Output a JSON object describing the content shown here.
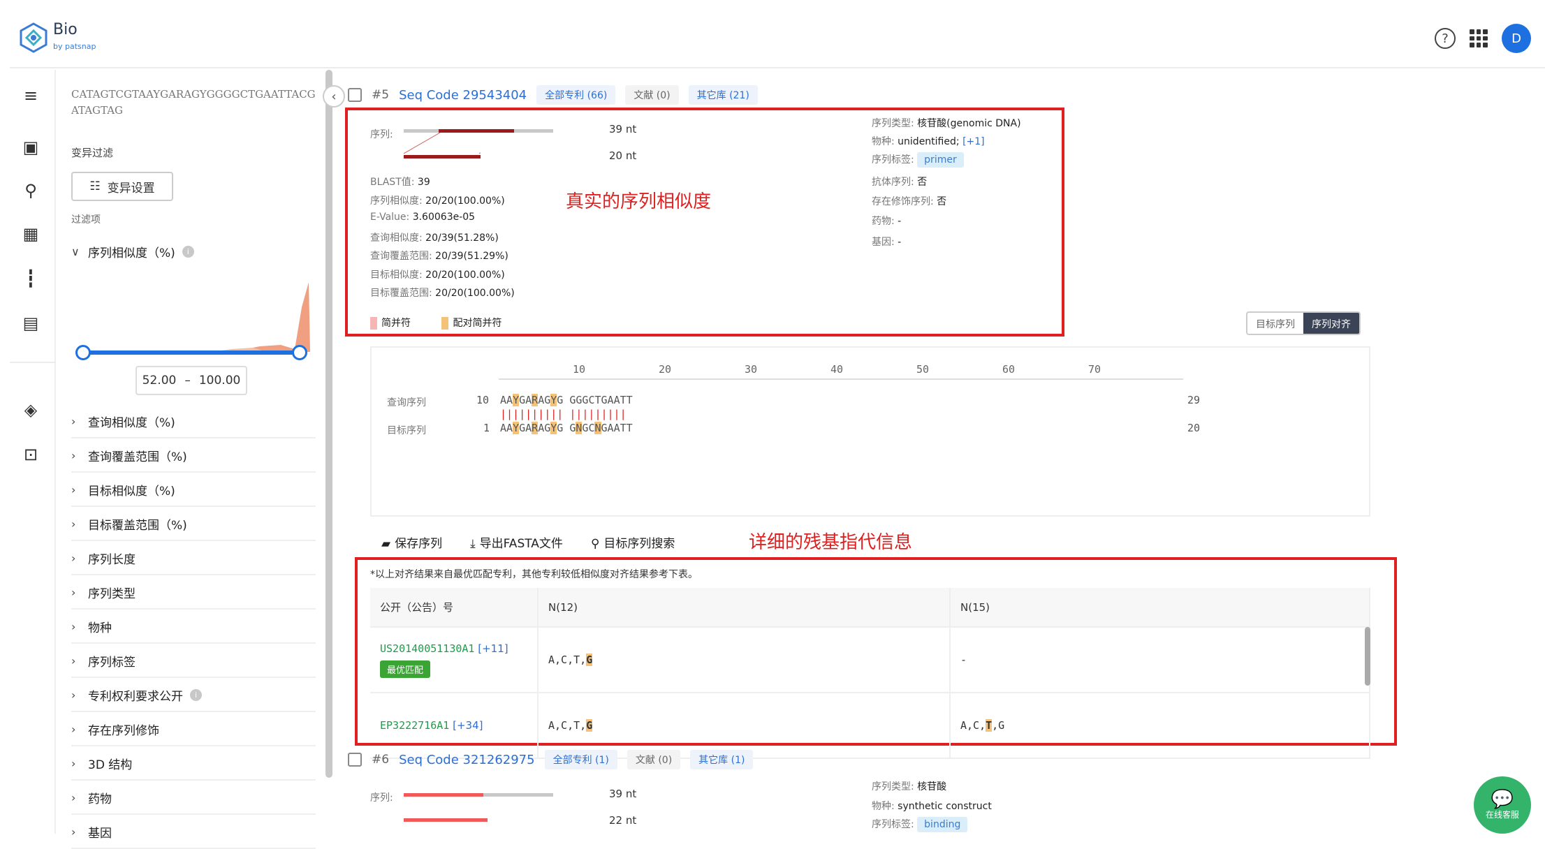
{
  "app": {
    "name": "Bio",
    "byline": "by patsnap",
    "avatar_letter": "D",
    "help_icon": "?"
  },
  "rail_icons": [
    "menu-collapse-icon",
    "document-icon",
    "search-icon",
    "structure-search-icon",
    "barcode-icon",
    "chart-icon",
    "layers-icon",
    "inbox-icon"
  ],
  "panel": {
    "query_sequence": "CATAGTCGTAAYGARAGYGGGGCTGAATTACGATAGTAG",
    "variant_filter_label": "变异过滤",
    "variant_button": "变异设置",
    "filters_label": "过滤项",
    "similarity_filter": "序列相似度（%)",
    "range_min": "52.00",
    "range_sep": "–",
    "range_max": "100.00",
    "filters": [
      "查询相似度（%)",
      "查询覆盖范围（%)",
      "目标相似度（%)",
      "目标覆盖范围（%)",
      "序列长度",
      "序列类型",
      "物种",
      "序列标签",
      "专利权利要求公开",
      "存在序列修饰",
      "3D 结构",
      "药物",
      "基因"
    ]
  },
  "result5": {
    "num": "#5",
    "seq_code": "Seq Code 29543404",
    "tags": [
      "全部专利 (66)",
      "文献 (0)",
      "其它库 (21)"
    ],
    "seq_label": "序列:",
    "query_len": "39 nt",
    "target_len": "20 nt",
    "metrics": [
      {
        "k": "BLAST值:",
        "v": "39"
      },
      {
        "k": "序列相似度:",
        "v": "20/20(100.00%)"
      },
      {
        "k": "E-Value:",
        "v": "3.60063e-05"
      },
      {
        "k": "查询相似度:",
        "v": "20/39(51.28%)"
      },
      {
        "k": "查询覆盖范围:",
        "v": "20/39(51.29%)"
      },
      {
        "k": "目标相似度:",
        "v": "20/20(100.00%)"
      },
      {
        "k": "目标覆盖范围:",
        "v": "20/20(100.00%)"
      }
    ],
    "right": [
      {
        "k": "序列类型:",
        "v": "核苷酸(genomic DNA)"
      },
      {
        "k": "物种:",
        "v": "unidentified;",
        "extra": "[+1]"
      },
      {
        "k": "序列标签:",
        "v": "primer"
      },
      {
        "k": "抗体序列:",
        "v": "否"
      },
      {
        "k": "存在修饰序列:",
        "v": "否"
      },
      {
        "k": "药物:",
        "v": "-"
      },
      {
        "k": "基因:",
        "v": "-"
      }
    ],
    "legend": [
      "简并符",
      "配对简并符"
    ],
    "annotation": "真实的序列相似度"
  },
  "toggle": {
    "a": "目标序列",
    "b": "序列对齐"
  },
  "alignment": {
    "ruler": [
      "10",
      "20",
      "30",
      "40",
      "50",
      "60",
      "70"
    ],
    "query_label": "查询序列",
    "query_start": "10",
    "query_seq": "AAYGARAGYG GGGCTGAATT",
    "query_end": "29",
    "pipes": "|||||||||| |||||||||",
    "target_label": "目标序列",
    "target_start": "1",
    "target_seq": "AAYGARAGYG GNGCNGAATT",
    "target_end": "20"
  },
  "actions": [
    "保存序列",
    "导出FASTA文件",
    "目标序列搜索"
  ],
  "annotation2": "详细的残基指代信息",
  "table": {
    "note": "*以上对齐结果来自最优匹配专利，其他专利较低相似度对齐结果参考下表。",
    "headers": [
      "公开（公告）号",
      "N(12)",
      "N(15)"
    ],
    "rows": [
      {
        "patent": "US20140051130A1",
        "more": "[+11]",
        "badge": "最优匹配",
        "n12": "A,C,T,",
        "n12_hl": "G",
        "n15": "-",
        "n15_hl": ""
      },
      {
        "patent": "EP3222716A1",
        "more": "[+34]",
        "badge": "",
        "n12": "A,C,T,",
        "n12_hl": "G",
        "n15": "A,C,",
        "n15_hl": "T",
        "n15_tail": ",G"
      }
    ]
  },
  "result6": {
    "num": "#6",
    "seq_code": "Seq Code 321262975",
    "tags": [
      "全部专利 (1)",
      "文献 (0)",
      "其它库 (1)"
    ],
    "seq_label": "序列:",
    "query_len": "39 nt",
    "target_len": "22 nt",
    "right": [
      {
        "k": "序列类型:",
        "v": "核苷酸"
      },
      {
        "k": "物种:",
        "v": "synthetic construct"
      },
      {
        "k": "序列标签:",
        "v": "binding"
      }
    ]
  },
  "chat": {
    "label": "在线客服"
  },
  "colors": {
    "accent": "#2b6fd6",
    "annotation_red": "#e02020",
    "bar_dark": "#9b1b1b",
    "bar_light": "#f05a5a",
    "legend_pink": "#f7b6b6",
    "legend_orange": "#f5c27a",
    "chat_green": "#34b36b"
  }
}
